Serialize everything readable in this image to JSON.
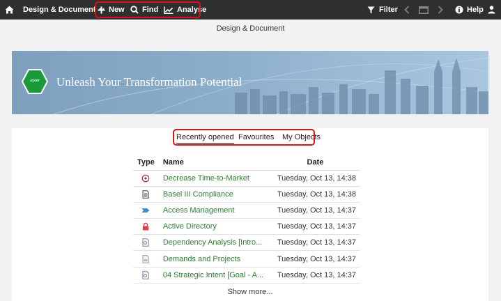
{
  "topbar": {
    "workspace_label": "Design & Document",
    "new_label": "New",
    "find_label": "Find",
    "analyse_label": "Analyse",
    "filter_label": "Filter",
    "help_label": "Help"
  },
  "page": {
    "title": "Design & Document"
  },
  "banner": {
    "title": "Unleash Your Transformation Potential",
    "logo_text": "ADOIT"
  },
  "tabs": [
    {
      "label": "Recently opened",
      "active": true
    },
    {
      "label": "Favourites",
      "active": false
    },
    {
      "label": "My Objects",
      "active": false
    }
  ],
  "table": {
    "headers": {
      "type": "Type",
      "name": "Name",
      "date": "Date"
    },
    "rows": [
      {
        "icon": "target-icon",
        "name": "Decrease Time-to-Market",
        "date": "Tuesday, Oct 13, 14:38"
      },
      {
        "icon": "document-icon",
        "name": "Basel III Compliance",
        "date": "Tuesday, Oct 13, 14:38"
      },
      {
        "icon": "chevron-process-icon",
        "name": "Access Management",
        "date": "Tuesday, Oct 13, 14:37"
      },
      {
        "icon": "lock-icon",
        "name": "Active Directory",
        "date": "Tuesday, Oct 13, 14:37"
      },
      {
        "icon": "diagram-icon",
        "name": "Dependency Analysis [Intro...",
        "date": "Tuesday, Oct 13, 14:37"
      },
      {
        "icon": "folder-icon",
        "name": "Demands and Projects",
        "date": "Tuesday, Oct 13, 14:37"
      },
      {
        "icon": "diagram-icon",
        "name": "04 Strategic Intent [Goal - A...",
        "date": "Tuesday, Oct 13, 14:37"
      }
    ],
    "show_more_label": "Show more..."
  },
  "colors": {
    "topbar": "#2f2f2f",
    "highlight": "#e0101a",
    "link_green": "#2e7d32",
    "hex_green": "#1a9a3a"
  }
}
